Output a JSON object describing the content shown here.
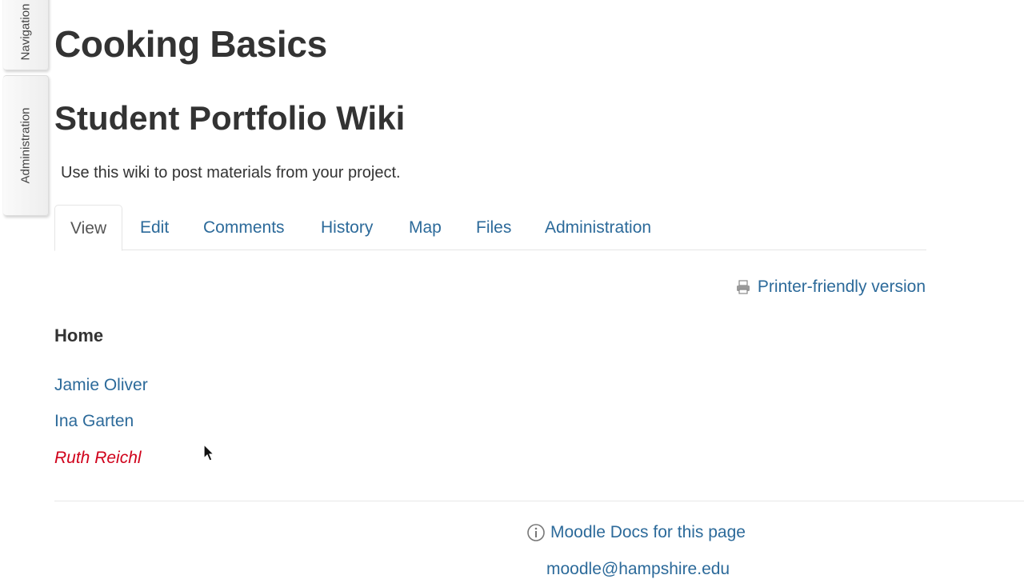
{
  "dock": {
    "navigation_label": "Navigation",
    "administration_label": "Administration"
  },
  "course": {
    "title": "Cooking Basics"
  },
  "wiki": {
    "title": "Student Portfolio Wiki",
    "intro": "Use this wiki to post materials from your project."
  },
  "tabs": [
    {
      "label": "View",
      "active": true
    },
    {
      "label": "Edit"
    },
    {
      "label": "Comments"
    },
    {
      "label": "History"
    },
    {
      "label": "Map"
    },
    {
      "label": "Files"
    },
    {
      "label": "Administration"
    }
  ],
  "printer": {
    "label": "Printer-friendly version",
    "icon": "printer-icon"
  },
  "page": {
    "heading": "Home",
    "links": [
      {
        "label": "Jamie Oliver",
        "exists": true
      },
      {
        "label": "Ina Garten",
        "exists": true
      },
      {
        "label": "Ruth Reichl",
        "exists": false
      }
    ]
  },
  "footer": {
    "docs_label": "Moodle Docs for this page",
    "docs_icon": "info-icon",
    "email": "moodle@hampshire.edu"
  },
  "colors": {
    "link": "#2c6a9a",
    "missing_link": "#d0021b",
    "text": "#333333"
  }
}
